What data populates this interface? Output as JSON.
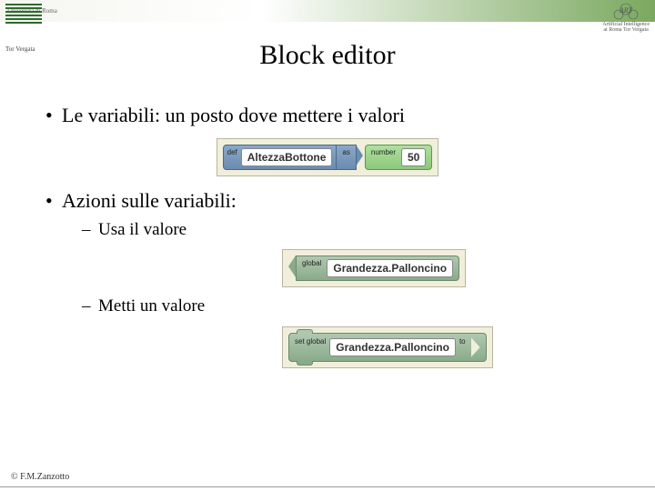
{
  "header": {
    "univ_text": "Università di Roma",
    "tor_vergata": "Tor Vergata",
    "art_line1": "Artificial Intelligence",
    "art_line2": "at Roma Tor Vergata"
  },
  "title": "Block editor",
  "bullets": {
    "b1": "Le variabili: un posto dove mettere i valori",
    "b2": "Azioni sulle variabili:",
    "s1": "Usa il valore",
    "s2": "Metti un valore"
  },
  "blocks": {
    "def": {
      "keyword": "def",
      "name": "AltezzaBottone",
      "as": "as"
    },
    "num": {
      "keyword": "number",
      "value": "50"
    },
    "get": {
      "keyword": "global",
      "name": "Grandezza.Palloncino"
    },
    "set": {
      "keyword": "set global",
      "name": "Grandezza.Palloncino",
      "to": "to"
    }
  },
  "footer": "© F.M.Zanzotto"
}
